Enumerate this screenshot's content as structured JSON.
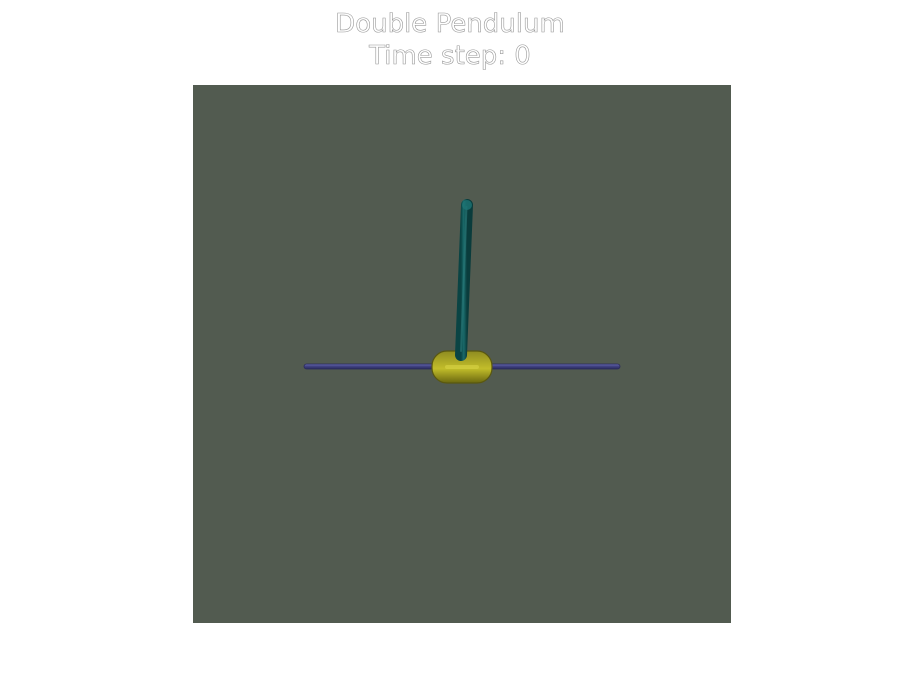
{
  "title": "Double Pendulum",
  "status": {
    "time_step_label": "Time step: 0"
  },
  "scene": {
    "background_color": "#525b50",
    "rail_color": "#3f4080",
    "cart_color": "#7d7a18",
    "pole_color": "#0f5656"
  }
}
